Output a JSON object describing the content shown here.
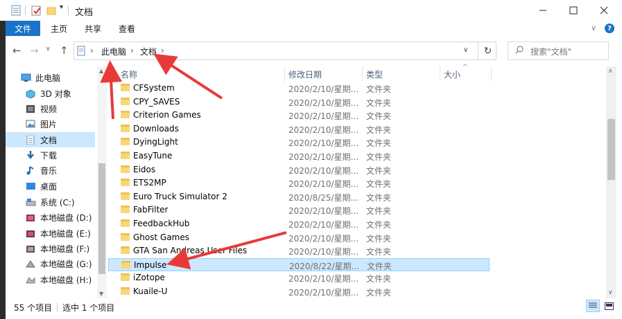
{
  "window": {
    "title": "文档",
    "controls": [
      "minimize-icon",
      "maximize-icon",
      "close-icon"
    ]
  },
  "ribbon": {
    "tabs": [
      "文件",
      "主页",
      "共享",
      "查看"
    ],
    "active": "文件"
  },
  "address": {
    "breadcrumb": [
      "此电脑",
      "文档"
    ]
  },
  "search": {
    "placeholder": "搜索\"文档\""
  },
  "sidebar": {
    "items": [
      {
        "label": "此电脑",
        "icon": "pc-icon"
      },
      {
        "label": "3D 对象",
        "icon": "cube-icon"
      },
      {
        "label": "视频",
        "icon": "video-icon"
      },
      {
        "label": "图片",
        "icon": "picture-icon"
      },
      {
        "label": "文档",
        "icon": "document-icon"
      },
      {
        "label": "下载",
        "icon": "download-icon"
      },
      {
        "label": "音乐",
        "icon": "music-icon"
      },
      {
        "label": "桌面",
        "icon": "desktop-icon"
      },
      {
        "label": "系统 (C:)",
        "icon": "drive-icon"
      },
      {
        "label": "本地磁盘 (D:)",
        "icon": "drive-icon"
      },
      {
        "label": "本地磁盘 (E:)",
        "icon": "drive-icon"
      },
      {
        "label": "本地磁盘 (F:)",
        "icon": "drive-icon"
      },
      {
        "label": "本地磁盘 (G:)",
        "icon": "drive-icon"
      },
      {
        "label": "本地磁盘 (H:)",
        "icon": "drive-icon"
      }
    ],
    "selected": "文档"
  },
  "columns": {
    "name": "名称",
    "date": "修改日期",
    "type": "类型",
    "size": "大小"
  },
  "files": [
    {
      "name": "CFSystem",
      "date": "2020/2/10/星期...",
      "type": "文件夹"
    },
    {
      "name": "CPY_SAVES",
      "date": "2020/2/10/星期...",
      "type": "文件夹"
    },
    {
      "name": "Criterion Games",
      "date": "2020/2/10/星期...",
      "type": "文件夹"
    },
    {
      "name": "Downloads",
      "date": "2020/2/10/星期...",
      "type": "文件夹"
    },
    {
      "name": "DyingLight",
      "date": "2020/2/10/星期...",
      "type": "文件夹"
    },
    {
      "name": "EasyTune",
      "date": "2020/2/10/星期...",
      "type": "文件夹"
    },
    {
      "name": "Eidos",
      "date": "2020/2/10/星期...",
      "type": "文件夹"
    },
    {
      "name": "ETS2MP",
      "date": "2020/2/10/星期...",
      "type": "文件夹"
    },
    {
      "name": "Euro Truck Simulator 2",
      "date": "2020/8/25/星期...",
      "type": "文件夹"
    },
    {
      "name": "FabFilter",
      "date": "2020/2/10/星期...",
      "type": "文件夹"
    },
    {
      "name": "FeedbackHub",
      "date": "2020/2/10/星期...",
      "type": "文件夹"
    },
    {
      "name": "Ghost Games",
      "date": "2020/2/10/星期...",
      "type": "文件夹"
    },
    {
      "name": "GTA San Andreas User Files",
      "date": "2020/2/10/星期...",
      "type": "文件夹"
    },
    {
      "name": "Impulse",
      "date": "2020/8/22/星期...",
      "type": "文件夹",
      "selected": true
    },
    {
      "name": "iZotope",
      "date": "2020/2/10/星期...",
      "type": "文件夹"
    },
    {
      "name": "Kuaile-U",
      "date": "2020/2/10/星期...",
      "type": "文件夹"
    }
  ],
  "status": {
    "count": "55 个项目",
    "selection": "选中 1 个项目"
  },
  "colors": {
    "accent": "#1a73c9",
    "selection_bg": "#cce8ff",
    "annotation_arrow": "#e8393a"
  }
}
